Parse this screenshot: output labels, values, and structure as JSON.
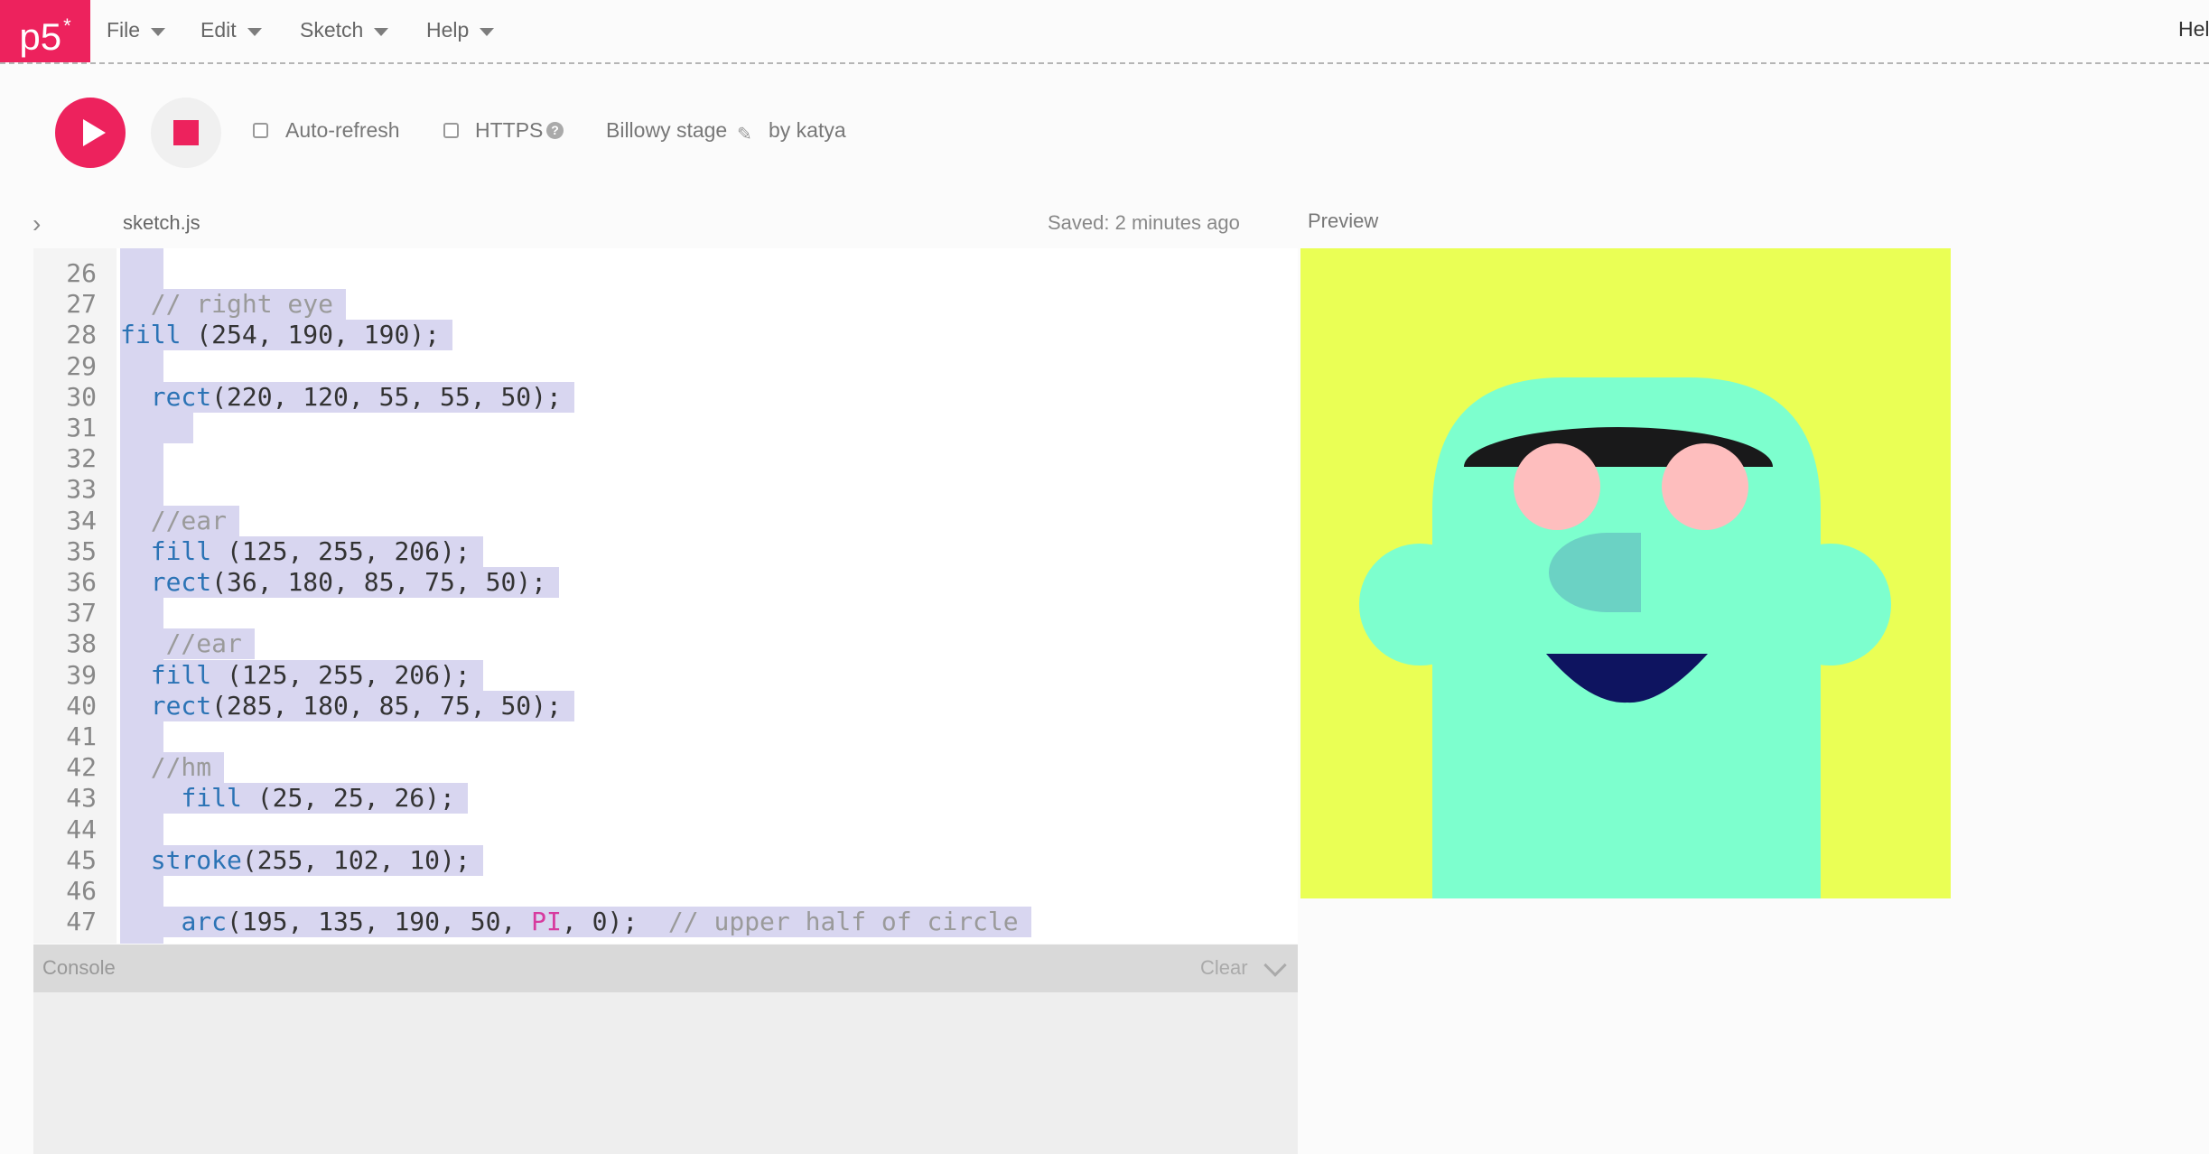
{
  "nav": {
    "logo": "p5",
    "logo_star": "*",
    "menus": [
      "File",
      "Edit",
      "Sketch",
      "Help"
    ],
    "right_text": "Hel"
  },
  "toolbar": {
    "auto_refresh_label": "Auto-refresh",
    "https_label": "HTTPS",
    "help_glyph": "?",
    "sketch_name": "Billowy stage",
    "by_label": "by katya"
  },
  "editor": {
    "file_name": "sketch.js",
    "saved_status": "Saved: 2 minutes ago",
    "lines": [
      {
        "n": "26",
        "parts": []
      },
      {
        "n": "27",
        "parts": [
          {
            "t": "  // right eye",
            "c": "cm"
          }
        ]
      },
      {
        "n": "28",
        "parts": [
          {
            "t": "fill",
            "c": "kw"
          },
          {
            "t": " (254, 190, 190);",
            "c": ""
          }
        ]
      },
      {
        "n": "29",
        "parts": []
      },
      {
        "n": "30",
        "parts": [
          {
            "t": "  ",
            "c": ""
          },
          {
            "t": "rect",
            "c": "kw"
          },
          {
            "t": "(220, 120, 55, 55, 50);",
            "c": ""
          }
        ]
      },
      {
        "n": "31",
        "parts": [
          {
            "t": "    ",
            "c": ""
          }
        ]
      },
      {
        "n": "32",
        "parts": []
      },
      {
        "n": "33",
        "parts": []
      },
      {
        "n": "34",
        "parts": [
          {
            "t": "  //ear",
            "c": "cm"
          }
        ]
      },
      {
        "n": "35",
        "parts": [
          {
            "t": "  ",
            "c": ""
          },
          {
            "t": "fill",
            "c": "kw"
          },
          {
            "t": " (125, 255, 206);",
            "c": ""
          }
        ]
      },
      {
        "n": "36",
        "parts": [
          {
            "t": "  ",
            "c": ""
          },
          {
            "t": "rect",
            "c": "kw"
          },
          {
            "t": "(36, 180, 85, 75, 50);",
            "c": ""
          }
        ]
      },
      {
        "n": "37",
        "parts": []
      },
      {
        "n": "38",
        "parts": [
          {
            "t": "   //ear",
            "c": "cm"
          }
        ]
      },
      {
        "n": "39",
        "parts": [
          {
            "t": "  ",
            "c": ""
          },
          {
            "t": "fill",
            "c": "kw"
          },
          {
            "t": " (125, 255, 206);",
            "c": ""
          }
        ]
      },
      {
        "n": "40",
        "parts": [
          {
            "t": "  ",
            "c": ""
          },
          {
            "t": "rect",
            "c": "kw"
          },
          {
            "t": "(285, 180, 85, 75, 50);",
            "c": ""
          }
        ]
      },
      {
        "n": "41",
        "parts": []
      },
      {
        "n": "42",
        "parts": [
          {
            "t": "  //hm",
            "c": "cm"
          }
        ]
      },
      {
        "n": "43",
        "parts": [
          {
            "t": "    ",
            "c": ""
          },
          {
            "t": "fill",
            "c": "kw"
          },
          {
            "t": " (25, 25, 26);",
            "c": ""
          }
        ]
      },
      {
        "n": "44",
        "parts": []
      },
      {
        "n": "45",
        "parts": [
          {
            "t": "  ",
            "c": ""
          },
          {
            "t": "stroke",
            "c": "kw"
          },
          {
            "t": "(255, 102, 10);",
            "c": ""
          }
        ]
      },
      {
        "n": "46",
        "parts": []
      },
      {
        "n": "47",
        "parts": [
          {
            "t": "    ",
            "c": ""
          },
          {
            "t": "arc",
            "c": "kw"
          },
          {
            "t": "(195, 135, 190, 50, ",
            "c": ""
          },
          {
            "t": "PI",
            "c": "pi"
          },
          {
            "t": ", 0);  ",
            "c": ""
          },
          {
            "t": "// upper half of circle",
            "c": "cm"
          }
        ]
      }
    ]
  },
  "console": {
    "title": "Console",
    "clear_label": "Clear"
  },
  "preview": {
    "label": "Preview",
    "colors": {
      "background": "#eaff55",
      "face": "#7dffce",
      "brow": "#19191a",
      "eye": "#febebe",
      "nose": "#6bd2c4",
      "mouth": "#0e1460"
    }
  },
  "accent_color": "#ed225d"
}
